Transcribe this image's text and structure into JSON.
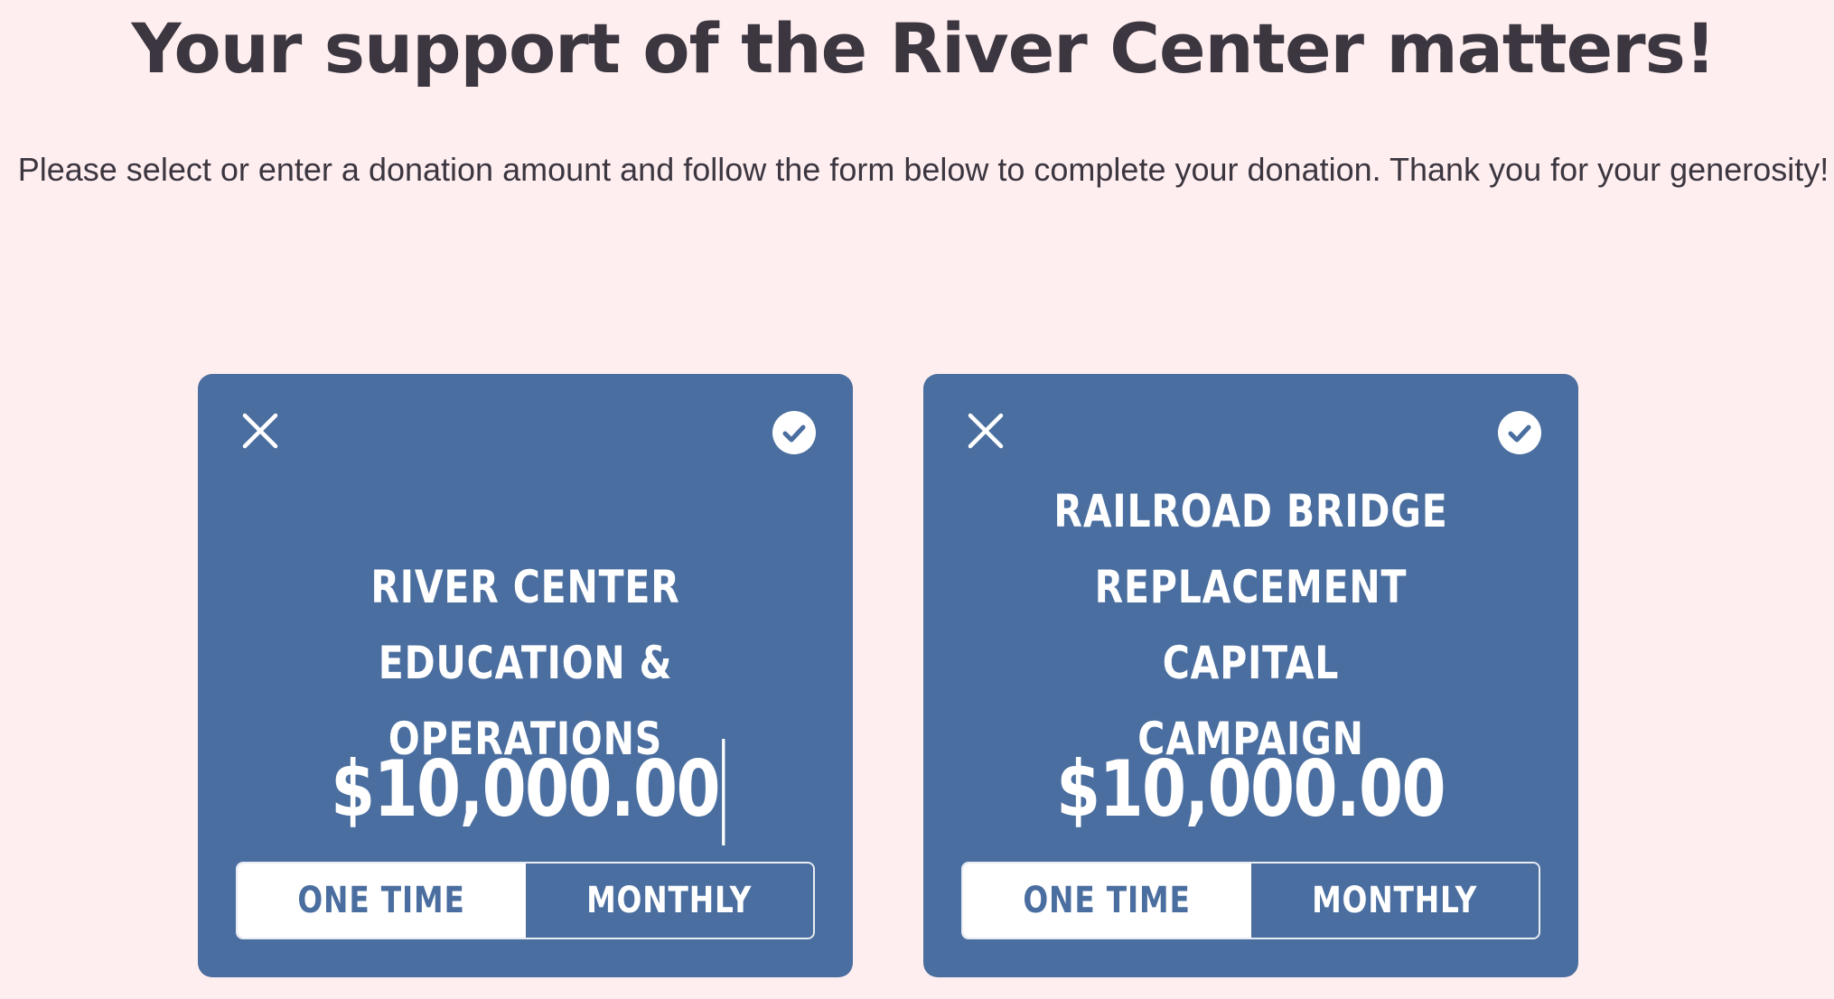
{
  "header": {
    "title": "Your support of the River Center matters!",
    "subtitle": "Please select or enter a donation amount and follow the form below to complete your donation. Thank you for your generosity!"
  },
  "colors": {
    "background": "#ffeeef",
    "card": "#4a6e9f",
    "text": "#3b363f"
  },
  "cards": [
    {
      "name_line1": "RIVER CENTER EDUCATION &",
      "name_line2": "OPERATIONS",
      "amount": "$10,000.00",
      "focused": true,
      "frequency_options": [
        "ONE TIME",
        "MONTHLY"
      ],
      "selected_frequency": "ONE TIME",
      "icons": {
        "close": "close-icon",
        "check": "check-circle-icon"
      }
    },
    {
      "name_line1": "RAILROAD BRIDGE",
      "name_line2": "REPLACEMENT CAPITAL",
      "name_line3": "CAMPAIGN",
      "amount": "$10,000.00",
      "focused": false,
      "frequency_options": [
        "ONE TIME",
        "MONTHLY"
      ],
      "selected_frequency": "ONE TIME",
      "icons": {
        "close": "close-icon",
        "check": "check-circle-icon"
      }
    }
  ]
}
